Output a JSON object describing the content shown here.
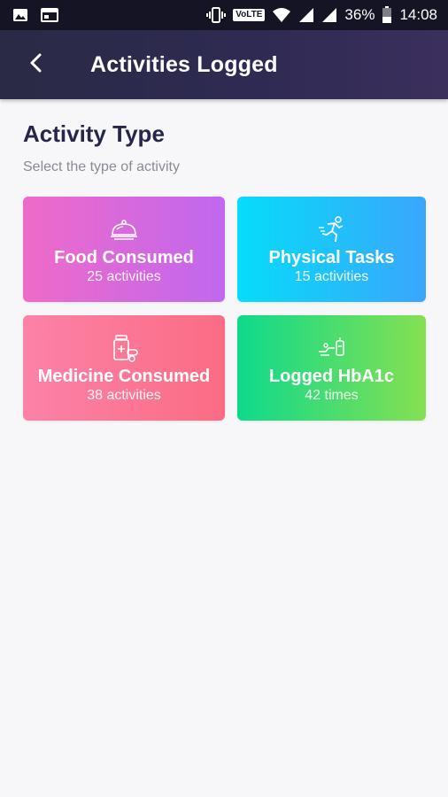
{
  "status_bar": {
    "battery_percent": "36%",
    "time": "14:08",
    "volte_label": "VoLTE",
    "icons": [
      "image-icon",
      "calendar-icon",
      "vibrate-icon",
      "wifi-icon",
      "signal-icon",
      "signal-icon",
      "battery-icon"
    ]
  },
  "app_bar": {
    "back_icon": "back-arrow-icon",
    "title": "Activities Logged"
  },
  "section": {
    "title": "Activity Type",
    "subtitle": "Select the type of activity"
  },
  "cards": [
    {
      "icon": "food-cloche-icon",
      "title": "Food Consumed",
      "subtitle": "25 activities",
      "gradient": [
        "#ef6ac8",
        "#c068ef"
      ]
    },
    {
      "icon": "running-person-icon",
      "title": "Physical Tasks",
      "subtitle": "15 activities",
      "gradient": [
        "#06dcfa",
        "#3aa6fb"
      ]
    },
    {
      "icon": "medicine-bottle-icon",
      "title": "Medicine Consumed",
      "subtitle": "38 activities",
      "gradient": [
        "#fb82a8",
        "#fb6c84"
      ]
    },
    {
      "icon": "glucose-meter-icon",
      "title": "Logged HbA1c",
      "subtitle": "42 times",
      "gradient": [
        "#0ed98c",
        "#86e052"
      ]
    }
  ],
  "colors": {
    "status_bar": "#141425",
    "app_bar": "#2e2a52",
    "title_text": "#26264a",
    "subtitle_text": "#8a8a96",
    "background": "#f7f7f9"
  }
}
